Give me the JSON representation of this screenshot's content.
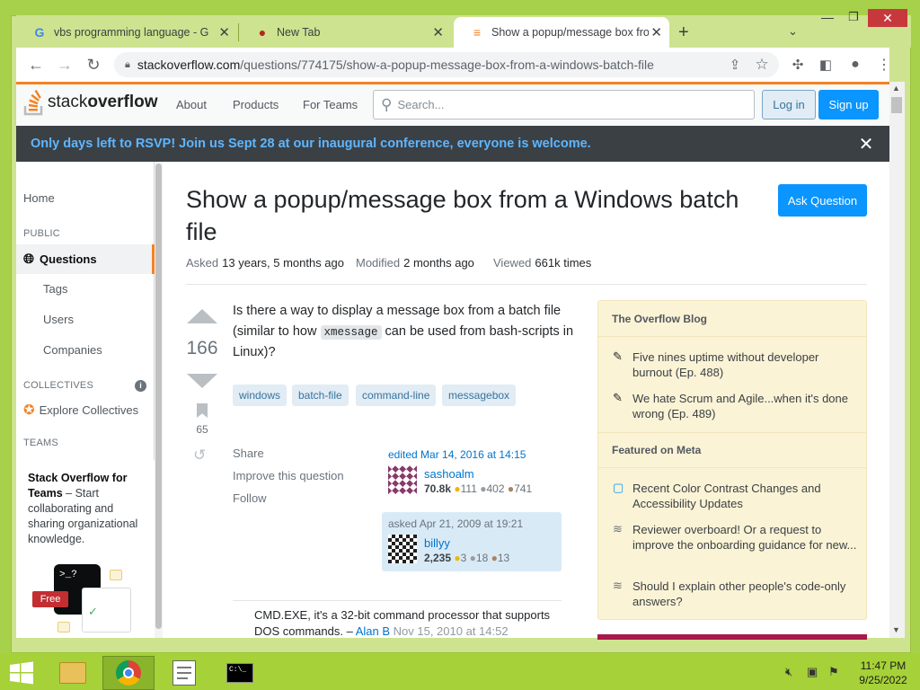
{
  "browser": {
    "tabs": [
      {
        "title": "vbs programming language - Go",
        "icon": "google-g-icon"
      },
      {
        "title": "New Tab",
        "icon": "ladybug-icon"
      },
      {
        "title": "Show a popup/message box from",
        "icon": "stackoverflow-icon"
      }
    ],
    "new_tab": "+",
    "url_domain": "stackoverflow.com",
    "url_path": "/questions/774175/show-a-popup-message-box-from-a-windows-batch-file"
  },
  "so": {
    "logo_pre": "stack",
    "logo_post": "overflow",
    "nav": [
      "About",
      "Products",
      "For Teams"
    ],
    "search_placeholder": "Search...",
    "login": "Log in",
    "signup": "Sign up",
    "banner": "Only days left to RSVP! Join us Sept 28 at our inaugural conference, everyone is welcome.",
    "left": {
      "home": "Home",
      "public": "PUBLIC",
      "questions": "Questions",
      "tags": "Tags",
      "users": "Users",
      "companies": "Companies",
      "collectives": "COLLECTIVES",
      "explore": "Explore Collectives",
      "teams": "TEAMS",
      "teams_title": "Stack Overflow for Teams",
      "teams_dash": " – Start collaborating and sharing organizational knowledge.",
      "free": "Free"
    },
    "question": {
      "title": "Show a popup/message box from a Windows batch file",
      "ask_button": "Ask Question",
      "asked_label": "Asked",
      "asked_value": "13 years, 5 months ago",
      "modified_label": "Modified",
      "modified_value": "2 months ago",
      "viewed_label": "Viewed",
      "viewed_value": "661k times",
      "votes": "166",
      "bookmarks": "65",
      "body_1": "Is there a way to display a message box from a batch file (similar to how ",
      "body_code": "xmessage",
      "body_2": " can be used from bash-scripts in Linux)?",
      "tags": [
        "windows",
        "batch-file",
        "command-line",
        "messagebox"
      ],
      "actions": [
        "Share",
        "Improve this question",
        "Follow"
      ],
      "edited": "edited Mar 14, 2016 at 14:15",
      "editor": "sashoalm",
      "editor_rep": "70.8k",
      "editor_badges": [
        "111",
        "402",
        "741"
      ],
      "asked_sig": "asked Apr 21, 2009 at 19:21",
      "asker": "billyy",
      "asker_rep": "2,235",
      "asker_badges": [
        "3",
        "18",
        "13"
      ],
      "comment": "CMD.EXE, it's a 32-bit command processor that supports DOS commands. – ",
      "comment_user": "Alan B",
      "comment_date": " Nov 15, 2010 at 14:52"
    },
    "widget": {
      "blog_header": "The Overflow Blog",
      "blog_items": [
        "Five nines uptime without developer burnout (Ep. 488)",
        "We hate Scrum and Agile...when it's done wrong (Ep. 489)"
      ],
      "meta_header": "Featured on Meta",
      "meta_items": [
        "Recent Color Contrast Changes and Accessibility Updates",
        "Reviewer overboard! Or a request to improve the onboarding guidance for new...",
        "Should I explain other people's code-only answers?"
      ]
    }
  },
  "taskbar": {
    "time": "11:47 PM",
    "date": "9/25/2022"
  },
  "colors": {
    "accent": "#f48225",
    "primary_button": "#0a95ff",
    "banner_bg": "#3b4045",
    "banner_text": "#5eb6ff",
    "tag_bg": "#e1ecf4",
    "widget_bg": "#fbf3d5"
  }
}
